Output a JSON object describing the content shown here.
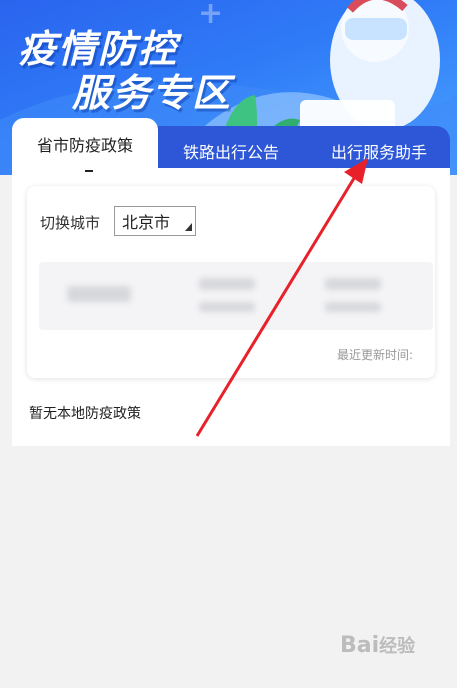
{
  "banner": {
    "line1": "疫情防控",
    "line2": "服务专区"
  },
  "tabs": [
    {
      "label": "省市防疫政策"
    },
    {
      "label": "铁路出行公告"
    },
    {
      "label": "出行服务助手"
    }
  ],
  "card": {
    "city_label": "切换城市",
    "city_value": "北京市",
    "update_time_label": "最近更新时间:"
  },
  "empty_message": "暂无本地防疫政策",
  "watermark": {
    "brand": "Bai",
    "suffix": "经验"
  },
  "colors": {
    "accent": "#2d57d6",
    "banner": "#2f7bf7",
    "arrow": "#e8202a"
  }
}
